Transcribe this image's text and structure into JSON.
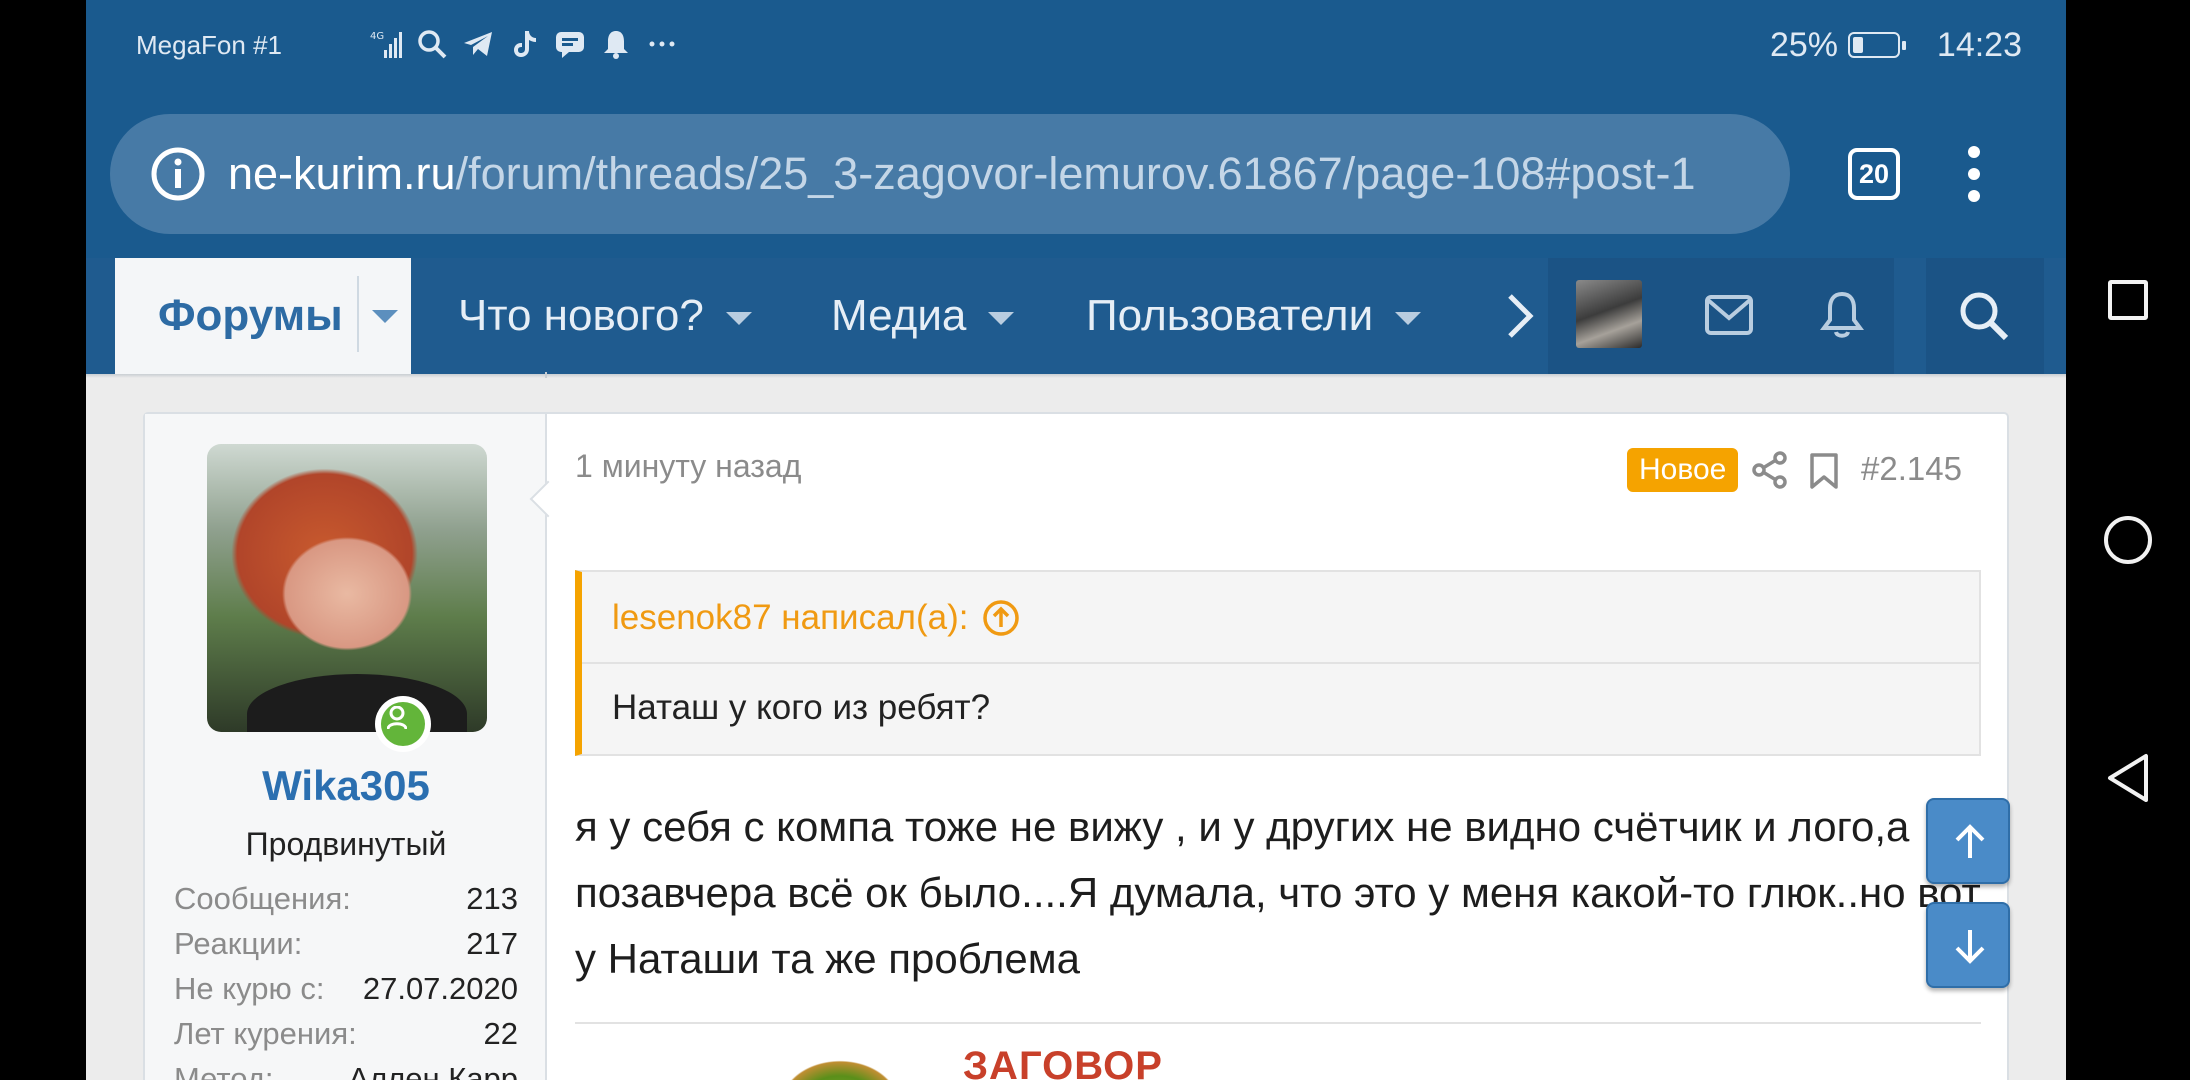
{
  "status_bar": {
    "carrier": "MegaFon #1",
    "battery": "25%",
    "time": "14:23",
    "icons": [
      "signal-4g-icon",
      "search-icon",
      "telegram-icon",
      "tiktok-icon",
      "chat-icon",
      "bell-icon",
      "more-icon"
    ]
  },
  "browser": {
    "url_domain": "ne-kurim.ru",
    "url_path": "/forum/threads/25_3-zagovor-lemurov.61867/page-108#post-1",
    "tab_count": "20"
  },
  "forum_nav": {
    "forums": "Форумы",
    "whats_new": "Что нового?",
    "media": "Медиа",
    "members": "Пользователи"
  },
  "post": {
    "time": "1 минуту назад",
    "new_badge": "Новое",
    "number": "#2.145",
    "user": {
      "name": "Wika305",
      "title": "Продвинутый",
      "stats": [
        {
          "label": "Сообщения:",
          "value": "213"
        },
        {
          "label": "Реакции:",
          "value": "217"
        },
        {
          "label": "Не курю с:",
          "value": "27.07.2020"
        },
        {
          "label": "Лет курения:",
          "value": "22"
        },
        {
          "label": "Метод:",
          "value": "Аллен Карр"
        }
      ]
    },
    "quote": {
      "author_line": "lesenok87 написал(а):",
      "text": "Наташ у кого из ребят?"
    },
    "body": "я у себя с компа тоже не вижу , и у других не видно счётчик и лого,а позавчера всё ок было....Я думала, что это у меня какой-то глюк..но вот у Наташи та же проблема",
    "signature_text": "ЗАГОВОР"
  },
  "colors": {
    "header_blue": "#1a5a8e",
    "accent_orange": "#f5a300",
    "username_blue": "#2b6fb0",
    "online_green": "#63b53a"
  }
}
